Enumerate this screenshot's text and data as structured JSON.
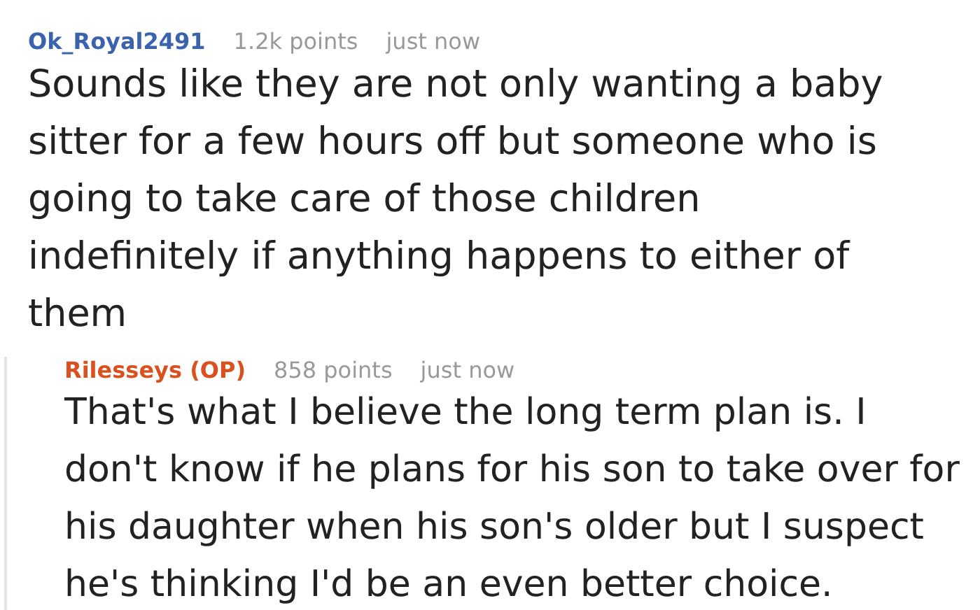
{
  "comments": [
    {
      "author": "Ok_Royal2491",
      "color": "#3b63ad",
      "points": "1.2k points",
      "time": "just now",
      "body": "Sounds like they are not only wanting a baby sitter for a few hours off but someone who is going to take care of those children indefinitely if anything happens to either of them",
      "children": [
        {
          "author": "Rilesseys (OP)",
          "color": "#d9511f",
          "points": "858 points",
          "time": "just now",
          "body": "That's what I believe the long term plan is. I don't know if he plans for his son to take over for his daughter when his son's older but I suspect he's thinking I'd be an even better choice."
        }
      ]
    }
  ]
}
